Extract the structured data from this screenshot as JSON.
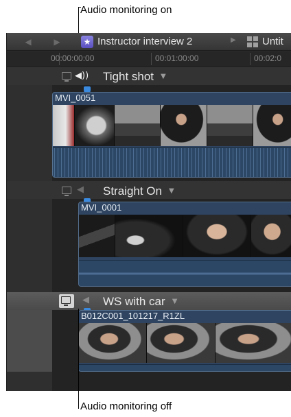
{
  "callouts": {
    "top": "Audio monitoring on",
    "bottom": "Audio monitoring off"
  },
  "toolbar": {
    "back_icon": "◀",
    "forward_icon": "▶",
    "project_star": "★",
    "project_title": "Instructor interview 2",
    "separator": "▶",
    "next_title": "Untit"
  },
  "ruler": {
    "timecodes": [
      "00:00:00:00",
      "00:01:00:00",
      "00:02:0"
    ]
  },
  "tracks": [
    {
      "title": "Tight shot",
      "clip_name": "MVI_0051",
      "audio_monitoring": "on",
      "arrow": "▼"
    },
    {
      "title": "Straight On",
      "clip_name": "MVI_0001",
      "audio_monitoring": "off",
      "arrow": "▼"
    },
    {
      "title": "WS with car",
      "clip_name": "B012C001_101217_R1ZL",
      "audio_monitoring": "off",
      "arrow": "▼"
    }
  ],
  "colors": {
    "clip_fill": "#2e4460",
    "clip_border": "#55708f",
    "playhead": "#3a8ae0",
    "project_icon": "#6a5fd0"
  }
}
